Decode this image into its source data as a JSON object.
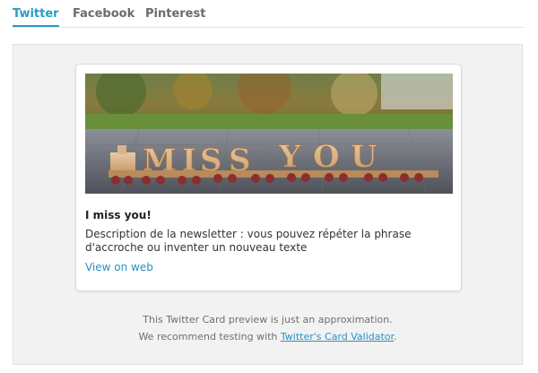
{
  "tabs": [
    {
      "label": "Twitter",
      "active": true
    },
    {
      "label": "Facebook",
      "active": false
    },
    {
      "label": "Pinterest",
      "active": false
    }
  ],
  "card": {
    "title": "I miss you!",
    "description": "Description de la newsletter : vous pouvez répéter la phrase d'accroche ou inventer un nouveau texte",
    "link_label": "View on web",
    "image_letters": "MISS YOU"
  },
  "footer": {
    "line1": "This Twitter Card preview is just an approximation.",
    "line2_prefix": "We recommend testing with ",
    "line2_link": "Twitter's Card Validator",
    "line2_suffix": "."
  },
  "colors": {
    "accent": "#2a9bc4",
    "link": "#2a90c4",
    "panel_bg": "#f2f2f2"
  }
}
